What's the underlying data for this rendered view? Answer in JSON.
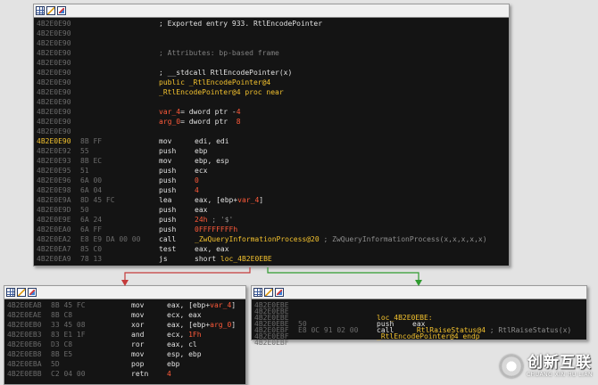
{
  "toolbar_icons": [
    "grid-icon",
    "pen-icon",
    "graph-icon"
  ],
  "main_block": {
    "lines": [
      {
        "addr": "4B2E0E90",
        "text": "; Exported entry 933. RtlEncodePointer",
        "tone": "op"
      },
      {
        "addr": "4B2E0E90"
      },
      {
        "addr": "4B2E0E90"
      },
      {
        "addr": "4B2E0E90",
        "text": "; Attributes: bp-based frame",
        "tone": "dim"
      },
      {
        "addr": "4B2E0E90"
      },
      {
        "addr": "4B2E0E90",
        "text": "; __stdcall RtlEncodePointer(x)",
        "tone": "op"
      },
      {
        "addr": "4B2E0E90",
        "text": "public _RtlEncodePointer@4",
        "tone": "lbl"
      },
      {
        "addr": "4B2E0E90",
        "text": "_RtlEncodePointer@4 proc near",
        "tone": "lbl"
      },
      {
        "addr": "4B2E0E90"
      },
      {
        "addr": "4B2E0E90",
        "text": "var_4= dword ptr -4",
        "tone": "mix",
        "parts": [
          {
            "t": "var_4",
            "c": "num"
          },
          {
            "t": "= dword ptr -",
            "c": "op"
          },
          {
            "t": "4",
            "c": "num"
          }
        ]
      },
      {
        "addr": "4B2E0E90",
        "text": "arg_0= dword ptr  8",
        "tone": "mix",
        "parts": [
          {
            "t": "arg_0",
            "c": "num"
          },
          {
            "t": "= dword ptr  ",
            "c": "op"
          },
          {
            "t": "8",
            "c": "num"
          }
        ]
      },
      {
        "addr": "4B2E0E90"
      },
      {
        "addr": "4B2E0E90",
        "hl": true,
        "bytes": "8B FF",
        "mn": "mov",
        "ops": [
          {
            "t": "edi, edi",
            "c": "op"
          }
        ]
      },
      {
        "addr": "4B2E0E92",
        "bytes": "55",
        "mn": "push",
        "ops": [
          {
            "t": "ebp",
            "c": "op"
          }
        ]
      },
      {
        "addr": "4B2E0E93",
        "bytes": "8B EC",
        "mn": "mov",
        "ops": [
          {
            "t": "ebp, esp",
            "c": "op"
          }
        ]
      },
      {
        "addr": "4B2E0E95",
        "bytes": "51",
        "mn": "push",
        "ops": [
          {
            "t": "ecx",
            "c": "op"
          }
        ]
      },
      {
        "addr": "4B2E0E96",
        "bytes": "6A 00",
        "mn": "push",
        "ops": [
          {
            "t": "0",
            "c": "num"
          }
        ]
      },
      {
        "addr": "4B2E0E98",
        "bytes": "6A 04",
        "mn": "push",
        "ops": [
          {
            "t": "4",
            "c": "num"
          }
        ]
      },
      {
        "addr": "4B2E0E9A",
        "bytes": "8D 45 FC",
        "mn": "lea",
        "ops": [
          {
            "t": "eax, [ebp+",
            "c": "op"
          },
          {
            "t": "var_4",
            "c": "num"
          },
          {
            "t": "]",
            "c": "op"
          }
        ]
      },
      {
        "addr": "4B2E0E9D",
        "bytes": "50",
        "mn": "push",
        "ops": [
          {
            "t": "eax",
            "c": "op"
          }
        ]
      },
      {
        "addr": "4B2E0E9E",
        "bytes": "6A 24",
        "mn": "push",
        "ops": [
          {
            "t": "24h",
            "c": "num"
          },
          {
            "t": " ; '$'",
            "c": "cm"
          }
        ]
      },
      {
        "addr": "4B2E0EA0",
        "bytes": "6A FF",
        "mn": "push",
        "ops": [
          {
            "t": "0FFFFFFFFh",
            "c": "num"
          }
        ]
      },
      {
        "addr": "4B2E0EA2",
        "bytes": "E8 E9 DA 00 00",
        "mn": "call",
        "ops": [
          {
            "t": "_ZwQueryInformationProcess@20",
            "c": "lbl"
          },
          {
            "t": " ; ZwQueryInformationProcess(x,x,x,x,x)",
            "c": "cm"
          }
        ]
      },
      {
        "addr": "4B2E0EA7",
        "bytes": "85 C0",
        "mn": "test",
        "ops": [
          {
            "t": "eax, eax",
            "c": "op"
          }
        ]
      },
      {
        "addr": "4B2E0EA9",
        "bytes": "78 13",
        "mn": "js",
        "ops": [
          {
            "t": "short ",
            "c": "op"
          },
          {
            "t": "loc_4B2E0EBE",
            "c": "lbl"
          }
        ]
      }
    ]
  },
  "left_block": {
    "lines": [
      {
        "addr": "4B2E0EAB",
        "bytes": "8B 45 FC",
        "mn": "mov",
        "ops": [
          {
            "t": "eax, [ebp+",
            "c": "op"
          },
          {
            "t": "var_4",
            "c": "num"
          },
          {
            "t": "]",
            "c": "op"
          }
        ]
      },
      {
        "addr": "4B2E0EAE",
        "bytes": "8B C8",
        "mn": "mov",
        "ops": [
          {
            "t": "ecx, eax",
            "c": "op"
          }
        ]
      },
      {
        "addr": "4B2E0EB0",
        "bytes": "33 45 08",
        "mn": "xor",
        "ops": [
          {
            "t": "eax, [ebp+",
            "c": "op"
          },
          {
            "t": "arg_0",
            "c": "num"
          },
          {
            "t": "]",
            "c": "op"
          }
        ]
      },
      {
        "addr": "4B2E0EB3",
        "bytes": "83 E1 1F",
        "mn": "and",
        "ops": [
          {
            "t": "ecx, ",
            "c": "op"
          },
          {
            "t": "1Fh",
            "c": "num"
          }
        ]
      },
      {
        "addr": "4B2E0EB6",
        "bytes": "D3 C8",
        "mn": "ror",
        "ops": [
          {
            "t": "eax, cl",
            "c": "op"
          }
        ]
      },
      {
        "addr": "4B2E0EB8",
        "bytes": "8B E5",
        "mn": "mov",
        "ops": [
          {
            "t": "esp, ebp",
            "c": "op"
          }
        ]
      },
      {
        "addr": "4B2E0EBA",
        "bytes": "5D",
        "mn": "pop",
        "ops": [
          {
            "t": "ebp",
            "c": "op"
          }
        ]
      },
      {
        "addr": "4B2E0EBB",
        "bytes": "C2 04 00",
        "mn": "retn",
        "ops": [
          {
            "t": "4",
            "c": "num"
          }
        ]
      }
    ]
  },
  "right_block": {
    "lines": [
      {
        "addr": "4B2E0EBE"
      },
      {
        "addr": "4B2E0EBE"
      },
      {
        "addr": "4B2E0EBE",
        "text": "loc_4B2E0EBE:",
        "tone": "lbl"
      },
      {
        "addr": "4B2E0EBE",
        "bytes": "50",
        "mn": "push",
        "ops": [
          {
            "t": "eax",
            "c": "op"
          }
        ]
      },
      {
        "addr": "4B2E0EBF",
        "bytes": "E8 0C 91 02 00",
        "mn": "call",
        "ops": [
          {
            "t": "_RtlRaiseStatus@4",
            "c": "lbl"
          },
          {
            "t": " ; RtlRaiseStatus(x)",
            "c": "cm"
          }
        ]
      },
      {
        "addr": "4B2E0EBF",
        "text": "_RtlEncodePointer@4 endp",
        "tone": "lbl"
      },
      {
        "addr": "4B2E0EBF"
      }
    ]
  },
  "edge_colors": {
    "false_branch": "#c43a3a",
    "true_branch": "#2f9a2f"
  },
  "watermark": {
    "cn": "创新互联",
    "en": "CHUANG XIN HU LIAN"
  }
}
